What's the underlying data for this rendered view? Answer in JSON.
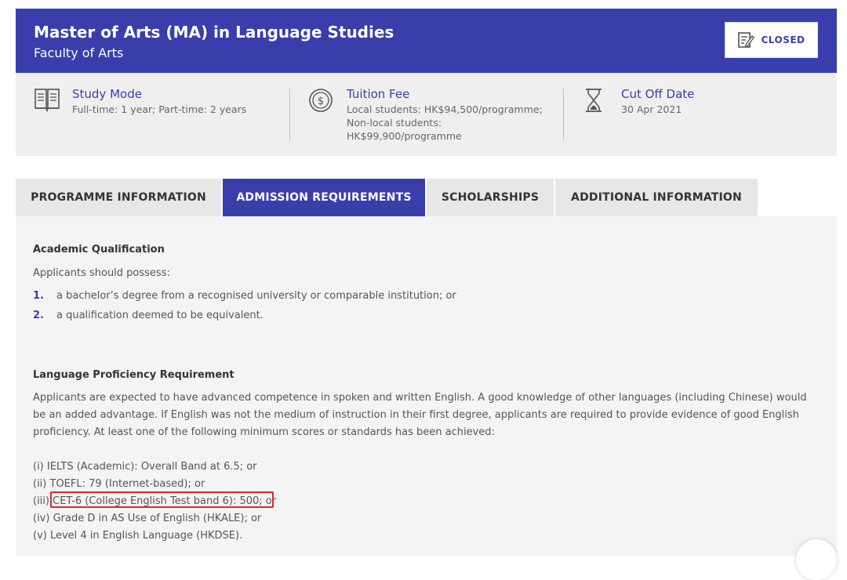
{
  "header": {
    "title": "Master of Arts (MA) in Language Studies",
    "subtitle": "Faculty of Arts",
    "closed_label": "CLOSED"
  },
  "info": {
    "study_mode": {
      "title": "Study Mode",
      "value": "Full-time: 1 year; Part-time: 2 years"
    },
    "tuition_fee": {
      "title": "Tuition Fee",
      "lines": [
        "Local students: HK$94,500/programme;",
        "Non-local students:",
        "HK$99,900/programme"
      ]
    },
    "cut_off": {
      "title": "Cut Off Date",
      "value": "30 Apr 2021"
    }
  },
  "tabs": [
    {
      "label": "PROGRAMME INFORMATION"
    },
    {
      "label": "ADMISSION REQUIREMENTS"
    },
    {
      "label": "SCHOLARSHIPS"
    },
    {
      "label": "ADDITIONAL INFORMATION"
    }
  ],
  "content": {
    "academic": {
      "heading": "Academic Qualification",
      "intro": "Applicants should possess:",
      "items": [
        {
          "num": "1.",
          "text": "a bachelor’s degree from a recognised university or comparable institution; or"
        },
        {
          "num": "2.",
          "text": "a qualification deemed to be equivalent."
        }
      ]
    },
    "language": {
      "heading": "Language Proficiency Requirement",
      "paragraph": "Applicants are expected to have advanced competence in spoken and written English. A good knowledge of other languages (including Chinese) would be an added advantage. If English was not the medium of instruction in their first degree, applicants are required to provide evidence of good English proficiency. At least one of the following minimum scores or standards has been achieved:",
      "scores": [
        "(i) IELTS (Academic): Overall Band at 6.5; or",
        "(ii) TOEFL: 79 (Internet-based); or",
        "(iii) CET-6 (College English Test band 6): 500; or",
        "(iv) Grade D in AS Use of English (HKALE); or",
        "(v) Level 4 in English Language (HKDSE)."
      ]
    }
  },
  "colors": {
    "primary": "#3a3eab",
    "highlight": "#e0262b"
  }
}
